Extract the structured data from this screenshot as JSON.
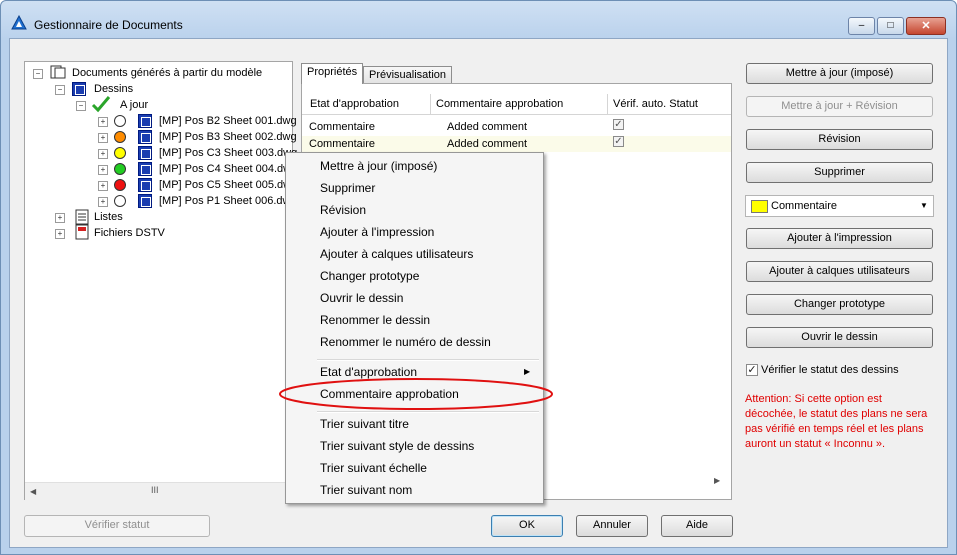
{
  "window": {
    "title": "Gestionnaire de Documents",
    "minimize": "‒",
    "maximize": "□",
    "close": "✕"
  },
  "tree": {
    "root": "Documents générés à partir du modèle",
    "dessins": "Dessins",
    "a_jour": "A jour",
    "items": [
      {
        "label": "[MP] Pos B2 Sheet 001.dwg",
        "status_color": "#ffffff"
      },
      {
        "label": "[MP] Pos B3 Sheet 002.dwg",
        "status_color": "#ff8c00"
      },
      {
        "label": "[MP] Pos C3 Sheet 003.dwg",
        "status_color": "#ffff00"
      },
      {
        "label": "[MP] Pos C4 Sheet 004.dw",
        "status_color": "#22cc22"
      },
      {
        "label": "[MP] Pos C5 Sheet 005.dw",
        "status_color": "#ee1111"
      },
      {
        "label": "[MP] Pos P1 Sheet 006.dw",
        "status_color": "#ffffff"
      }
    ],
    "listes": "Listes",
    "fichiers": "Fichiers DSTV",
    "hscroll_grip": "III"
  },
  "tabs": {
    "proprietes": "Propriétés",
    "previsualisation": "Prévisualisation"
  },
  "grid": {
    "columns": [
      "Etat d'approbation",
      "Commentaire approbation",
      "Vérif. auto. Statut"
    ],
    "rows": [
      {
        "etat": "Commentaire",
        "commentaire": "Added comment",
        "verif": "✓"
      },
      {
        "etat": "Commentaire",
        "commentaire": "Added comment",
        "verif": "✓"
      }
    ]
  },
  "context_menu": {
    "group1": [
      "Mettre à jour (imposé)",
      "Supprimer",
      "Révision",
      "Ajouter à l'impression",
      "Ajouter à calques utilisateurs",
      "Changer prototype",
      "Ouvrir le dessin",
      "Renommer le dessin",
      "Renommer le numéro de dessin"
    ],
    "group2": [
      "Etat d'approbation",
      "Commentaire approbation"
    ],
    "group3": [
      "Trier suivant titre",
      "Trier suivant style de dessins",
      "Trier suivant échelle",
      "Trier suivant nom"
    ],
    "submenu_arrow": "▶",
    "highlight_color": "#e01010"
  },
  "right_panel": {
    "btn_update_forced": "Mettre à jour (imposé)",
    "btn_update_revision": "Mettre à jour + Révision",
    "btn_revision": "Révision",
    "btn_delete": "Supprimer",
    "combo_value": "Commentaire",
    "combo_swatch": "#ffff00",
    "btn_add_print": "Ajouter à l'impression",
    "btn_add_layers": "Ajouter à calques utilisateurs",
    "btn_change_proto": "Changer prototype",
    "btn_open": "Ouvrir le dessin",
    "check_label": "Vérifier le statut des dessins",
    "check_mark": "✓",
    "warning": "Attention: Si cette option est décochée, le statut des plans ne sera pas vérifié en temps réel et les plans auront un statut « Inconnu »."
  },
  "footer": {
    "verify": "Vérifier statut",
    "ok": "OK",
    "cancel": "Annuler",
    "help": "Aide"
  }
}
